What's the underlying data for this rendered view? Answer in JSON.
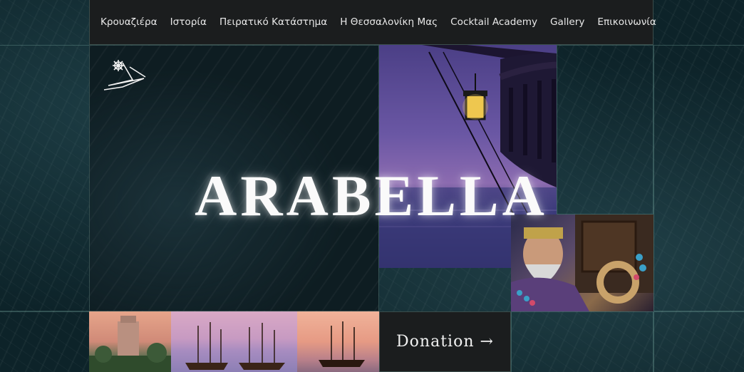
{
  "nav": {
    "items": [
      {
        "label": "Κρουαζιέρα"
      },
      {
        "label": "Ιστορία"
      },
      {
        "label": "Πειρατικό Κατάστημα"
      },
      {
        "label": "Η Θεσσαλονίκη Μας"
      },
      {
        "label": "Cocktail Academy"
      },
      {
        "label": "Gallery"
      },
      {
        "label": "Επικοινωνία"
      }
    ],
    "languages": [
      "greek-flag-icon",
      "english-flag-icon"
    ]
  },
  "hero": {
    "title": "ARABELLA"
  },
  "donation": {
    "label": "Donation →"
  },
  "colors": {
    "navbar_bg": "#1b1d1e",
    "sea_bg": "#0d2329",
    "text": "#e9e9e9"
  }
}
